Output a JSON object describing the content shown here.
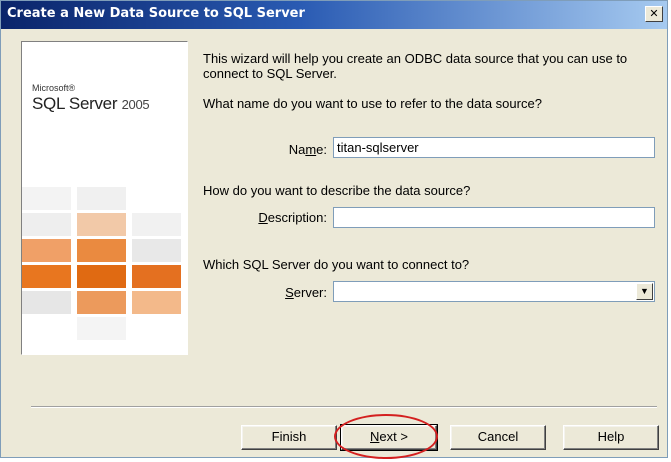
{
  "window": {
    "title": "Create a New Data Source to SQL Server",
    "close_glyph": "✕"
  },
  "banner": {
    "brand": "Microsoft®",
    "product": "SQL Server",
    "version": "2005",
    "tile_colors": {
      "pale": "#f4f4f4",
      "light_gray": "#e6e6e6",
      "peach": "#f2c9a8",
      "light_orange": "#f0a067",
      "orange": "#e8761f",
      "dark_orange": "#e06a12"
    }
  },
  "content": {
    "intro": "This wizard will help you create an ODBC data source that you can use to connect to SQL Server.",
    "q_name": "What name do you want to use to refer to the data source?",
    "q_description": "How do you want to describe the data source?",
    "q_server": "Which SQL Server do you want to connect to?"
  },
  "fields": {
    "name": {
      "label_pre": "Na",
      "label_acc": "m",
      "label_post": "e:",
      "value": "titan-sqlserver"
    },
    "description": {
      "label_pre": "",
      "label_acc": "D",
      "label_post": "escription:",
      "value": ""
    },
    "server": {
      "label_pre": "",
      "label_acc": "S",
      "label_post": "erver:",
      "value": "",
      "arrow": "▼"
    }
  },
  "buttons": {
    "finish": "Finish",
    "next_acc": "N",
    "next_post": "ext >",
    "cancel": "Cancel",
    "help": "Help"
  },
  "colors": {
    "dialog_bg": "#ece9d8",
    "title_start": "#0a246a",
    "title_end": "#a6caf0",
    "annotation": "#d42020"
  }
}
